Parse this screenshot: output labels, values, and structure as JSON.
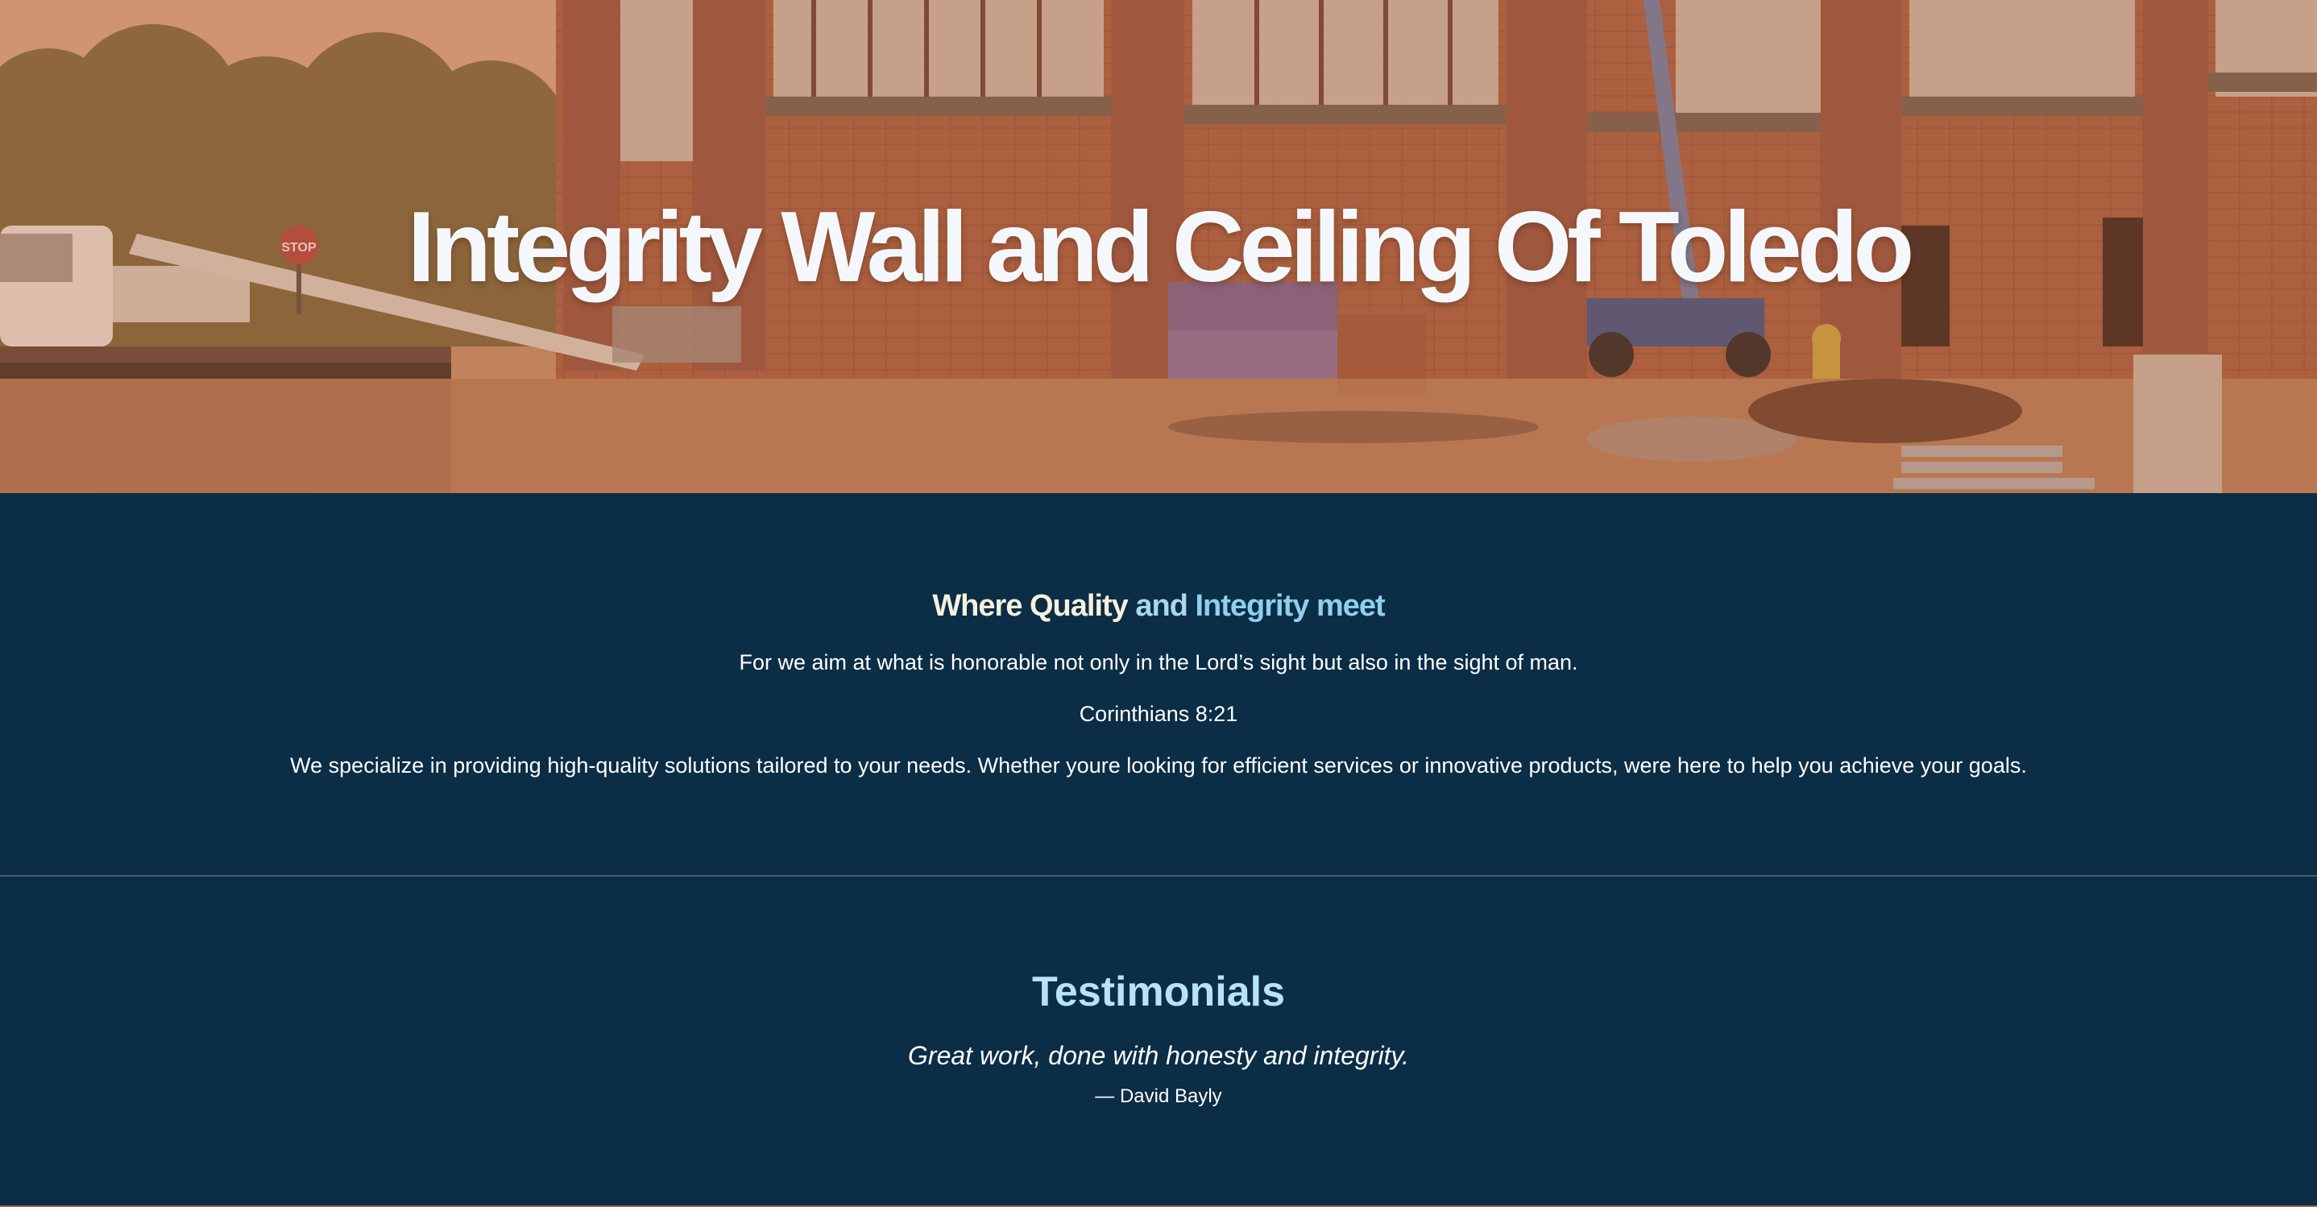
{
  "hero": {
    "title": "Integrity Wall and Ceiling Of Toledo",
    "stop_sign_text": "STOP",
    "background_image": "construction-site-photo"
  },
  "about": {
    "heading_part1": "Where Quality",
    "heading_part2": "and",
    "heading_part3": "Integrity meet",
    "quote": "For we aim at what is honorable not only in the Lord’s sight but also in the sight of man.",
    "reference": "Corinthians 8:21",
    "description": "We specialize in providing high-quality solutions tailored to your needs. Whether youre looking for efficient services or innovative products, were here to help you achieve your goals."
  },
  "testimonials": {
    "heading": "Testimonials",
    "quote": "Great work, done with honesty and integrity.",
    "author": "— David Bayly"
  },
  "colors": {
    "page_background": "#0b2d46",
    "hero_tint": "#b9764f",
    "heading_cream": "#f6f1dc",
    "heading_light_blue": "#a9d8ee",
    "testimonial_heading": "#b7e3f4",
    "divider": "#4a5a66"
  }
}
